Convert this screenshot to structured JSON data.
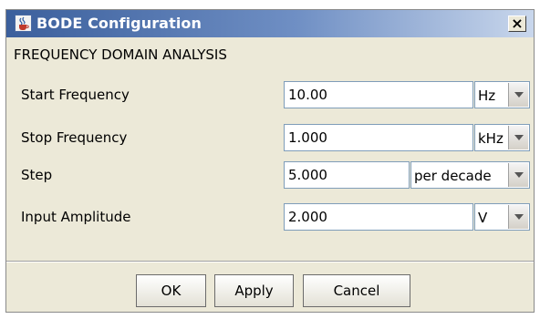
{
  "window": {
    "title": "BODE Configuration",
    "close_label": "×"
  },
  "section_title": "FREQUENCY DOMAIN ANALYSIS",
  "fields": [
    {
      "label": "Start Frequency",
      "value": "10.00",
      "unit": "Hz"
    },
    {
      "label": "Stop Frequency",
      "value": "1.000",
      "unit": "kHz"
    },
    {
      "label": "Step",
      "value": "5.000",
      "unit": "per decade"
    },
    {
      "label": "Input Amplitude",
      "value": "2.000",
      "unit": "V"
    }
  ],
  "buttons": {
    "ok": "OK",
    "apply": "Apply",
    "cancel": "Cancel"
  }
}
